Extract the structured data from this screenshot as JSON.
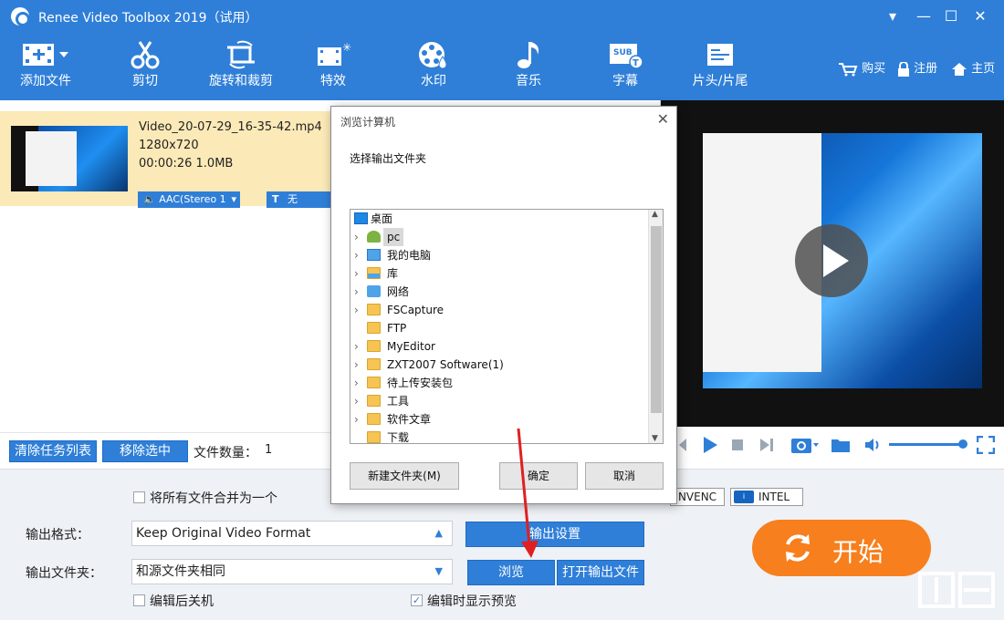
{
  "app": {
    "title": "Renee Video Toolbox 2019（试用）",
    "window_controls": [
      "▾",
      "—",
      "☐",
      "✕"
    ]
  },
  "toolbar": {
    "items": [
      {
        "label": "添加文件",
        "icon": "add-file-icon"
      },
      {
        "label": "剪切",
        "icon": "scissors-icon"
      },
      {
        "label": "旋转和裁剪",
        "icon": "rotate-crop-icon"
      },
      {
        "label": "特效",
        "icon": "effects-icon"
      },
      {
        "label": "水印",
        "icon": "watermark-icon"
      },
      {
        "label": "音乐",
        "icon": "music-icon"
      },
      {
        "label": "字幕",
        "icon": "subtitle-icon"
      },
      {
        "label": "片头/片尾",
        "icon": "intro-outro-icon"
      }
    ],
    "right_links": {
      "buy": "购买",
      "register": "注册",
      "home": "主页"
    }
  },
  "file": {
    "name": "Video_20-07-29_16-35-42.mp4",
    "resolution": "1280x720",
    "duration_size": "00:00:26 1.0MB",
    "audio_track": "AAC(Stereo 1",
    "subtitle": "无"
  },
  "list_bar": {
    "clear_label": "清除任务列表",
    "remove_label": "移除选中",
    "count_label": "文件数量：",
    "count_value": "1"
  },
  "settings": {
    "merge_label": "将所有文件合并为一个",
    "format_label": "输出格式：",
    "format_value": "Keep Original Video Format",
    "output_settings": "输出设置",
    "folder_label": "输出文件夹：",
    "folder_value": "和源文件夹相同",
    "browse": "浏览",
    "open_folder": "打开输出文件",
    "shutdown_label": "编辑后关机",
    "shutdown_checked": false,
    "preview_label": "编辑时显示预览",
    "preview_checked": true,
    "badges": [
      "NVENC",
      "INTEL"
    ],
    "start": "开始"
  },
  "dialog": {
    "title": "浏览计算机",
    "prompt": "选择输出文件夹",
    "tree": [
      {
        "label": "桌面",
        "icon": "desktop-icon",
        "chevron": false,
        "level": 0
      },
      {
        "label": "pc",
        "icon": "user-icon",
        "chevron": true,
        "level": 1,
        "selected": true
      },
      {
        "label": "我的电脑",
        "icon": "computer-icon",
        "chevron": true,
        "level": 1
      },
      {
        "label": "库",
        "icon": "library-icon",
        "chevron": true,
        "level": 1
      },
      {
        "label": "网络",
        "icon": "network-icon",
        "chevron": true,
        "level": 1
      },
      {
        "label": "FSCapture",
        "icon": "folder-icon",
        "chevron": true,
        "level": 1
      },
      {
        "label": "FTP",
        "icon": "folder-icon",
        "chevron": false,
        "level": 1
      },
      {
        "label": "MyEditor",
        "icon": "folder-icon",
        "chevron": true,
        "level": 1
      },
      {
        "label": "ZXT2007 Software(1)",
        "icon": "folder-icon",
        "chevron": true,
        "level": 1
      },
      {
        "label": "待上传安装包",
        "icon": "folder-icon",
        "chevron": true,
        "level": 1
      },
      {
        "label": "工具",
        "icon": "folder-icon",
        "chevron": true,
        "level": 1
      },
      {
        "label": "软件文章",
        "icon": "folder-icon",
        "chevron": true,
        "level": 1
      },
      {
        "label": "下载",
        "icon": "folder-icon",
        "chevron": false,
        "level": 1
      }
    ],
    "new_folder": "新建文件夹(M)",
    "ok": "确定",
    "cancel": "取消"
  },
  "colors": {
    "accent": "#2f7fd8",
    "start": "#f77f1d",
    "selected_row": "#fbe9b7",
    "arrow": "#e02020"
  }
}
